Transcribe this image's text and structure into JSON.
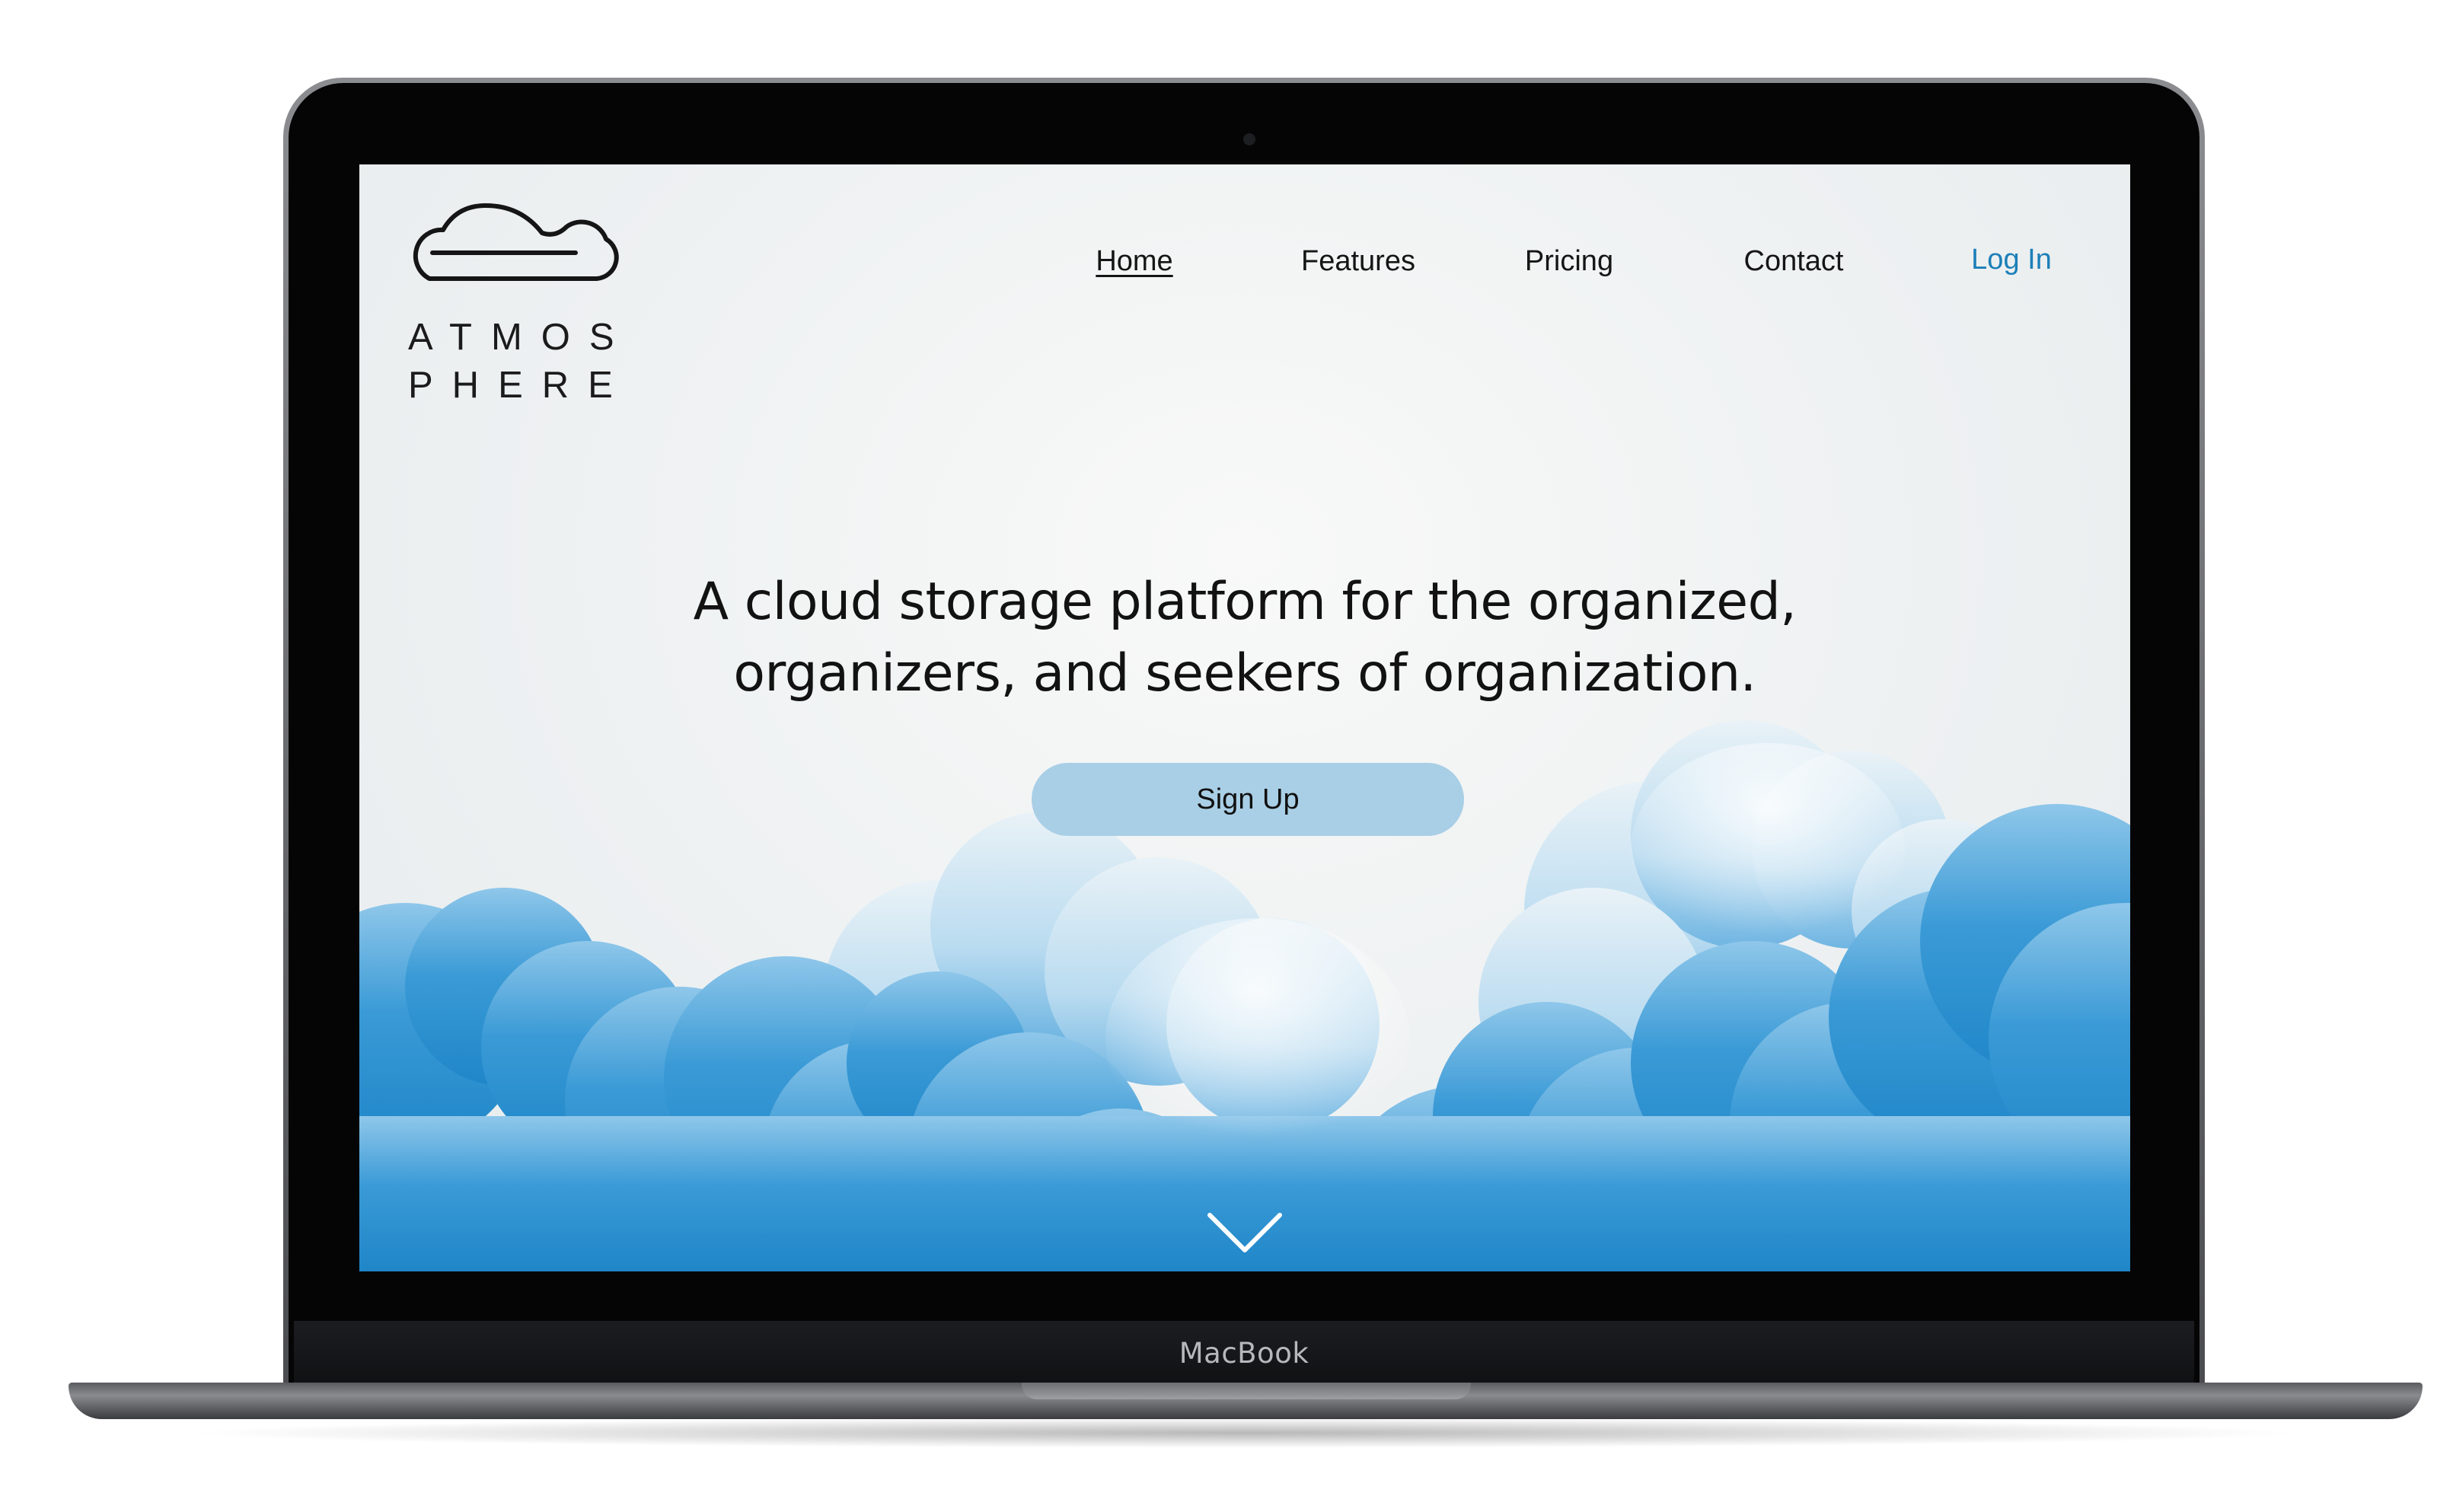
{
  "device": {
    "brand_label": "MacBook"
  },
  "site": {
    "logo": {
      "icon": "cloud-outline-icon",
      "line1": "ATMOS",
      "line2": "PHERE"
    },
    "nav": {
      "items": [
        {
          "label": "Home",
          "active": true
        },
        {
          "label": "Features",
          "active": false
        },
        {
          "label": "Pricing",
          "active": false
        },
        {
          "label": "Contact",
          "active": false
        }
      ],
      "login_label": "Log In"
    },
    "hero": {
      "title_line1": "A cloud storage platform for the organized,",
      "title_line2": "organizers, and seekers of organization.",
      "signup_label": "Sign Up",
      "scroll_icon": "chevron-down-icon"
    },
    "colors": {
      "accent_link": "#1c7fb8",
      "button_bg": "#a9cfe6",
      "cloud_blue": "#2f93d0"
    }
  }
}
